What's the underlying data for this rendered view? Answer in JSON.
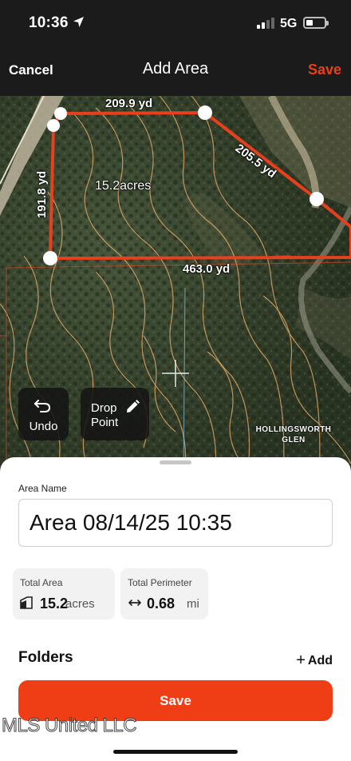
{
  "status_bar": {
    "time": "10:36",
    "network": "5G"
  },
  "nav": {
    "cancel_label": "Cancel",
    "title": "Add Area",
    "save_label": "Save"
  },
  "map": {
    "measurements": {
      "top": "209.9 yd",
      "diagonal": "205.5 yd",
      "left": "191.8 yd",
      "bottom": "463.0 yd"
    },
    "area_label": "15.2acres",
    "place_label": "HOLLINGSWORTH GLEN",
    "undo_label": "Undo",
    "drop_point_label": "Drop Point"
  },
  "sheet": {
    "area_name_label": "Area Name",
    "area_name_value": "Area 08/14/25 10:35",
    "total_area": {
      "title": "Total Area",
      "value": "15.2",
      "unit": "acres"
    },
    "total_perimeter": {
      "title": "Total Perimeter",
      "value": "0.68",
      "unit": "mi"
    },
    "folders_title": "Folders",
    "folders_add_label": "Add",
    "save_label": "Save"
  },
  "watermark": "MLS United LLC",
  "colors": {
    "accent": "#ef3e16",
    "boundary": "#e8401d",
    "bar": "#1b1b1b"
  }
}
